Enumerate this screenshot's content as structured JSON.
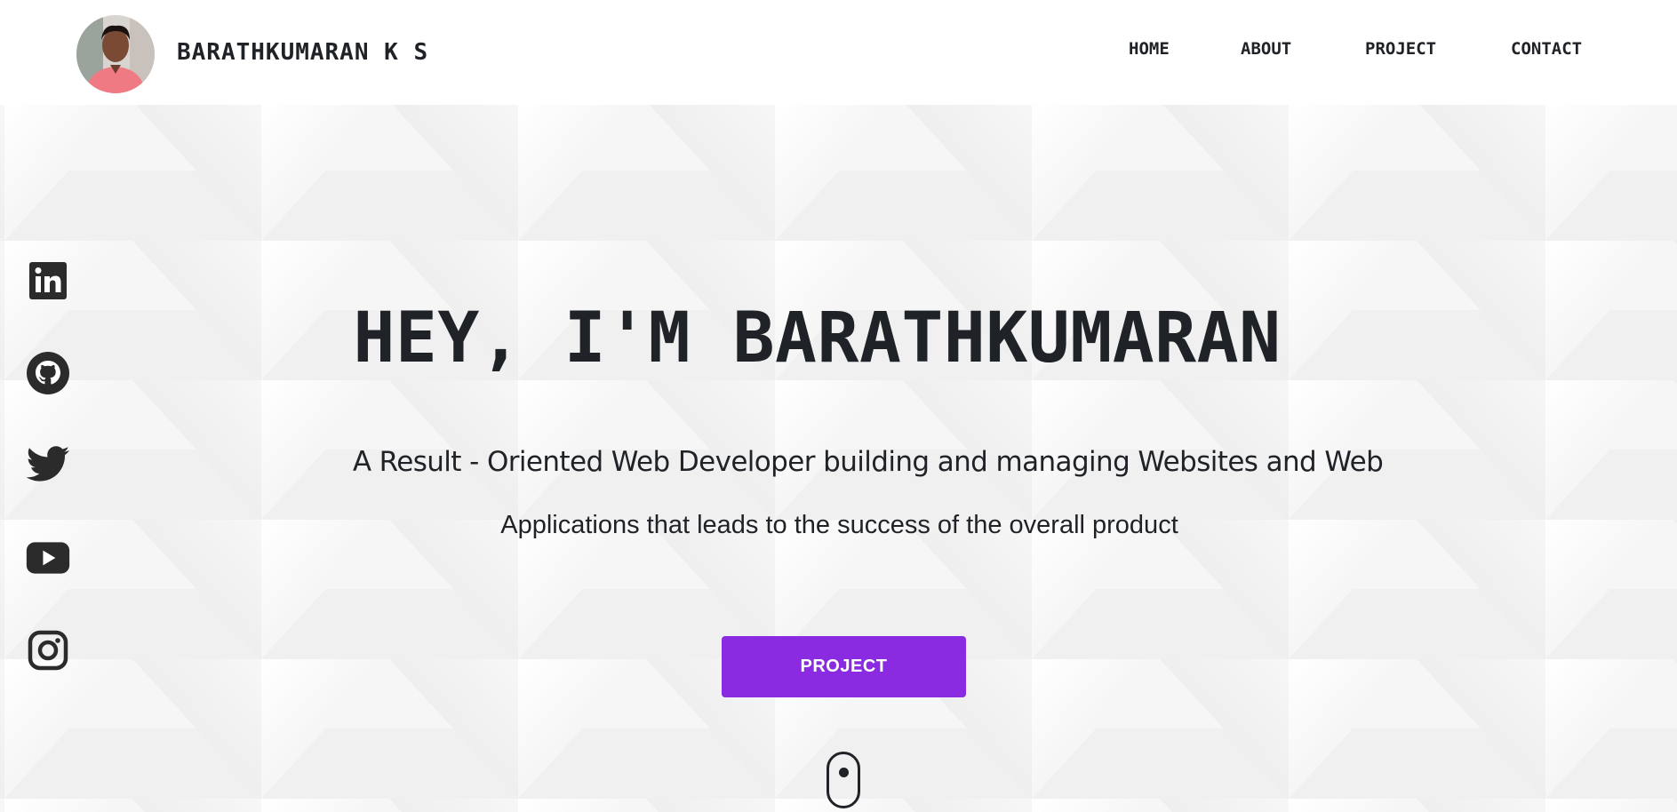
{
  "header": {
    "brand": "BARATHKUMARAN K S",
    "nav": {
      "home": "HOME",
      "about": "ABOUT",
      "project": "PROJECT",
      "contact": "CONTACT"
    }
  },
  "hero": {
    "headline": "HEY, I'M BARATHKUMARAN",
    "subtitle_line1": "A Result - Oriented Web Developer building and managing Websites and Web",
    "subtitle_line2": "Applications that leads to the success of the overall product",
    "cta_label": "PROJECT"
  },
  "socials": [
    {
      "icon": "linkedin-icon"
    },
    {
      "icon": "github-icon"
    },
    {
      "icon": "twitter-icon"
    },
    {
      "icon": "youtube-icon"
    },
    {
      "icon": "instagram-icon"
    }
  ],
  "colors": {
    "accent": "#8a2be2",
    "text": "#1f2226",
    "background": "#f3f3f3"
  }
}
